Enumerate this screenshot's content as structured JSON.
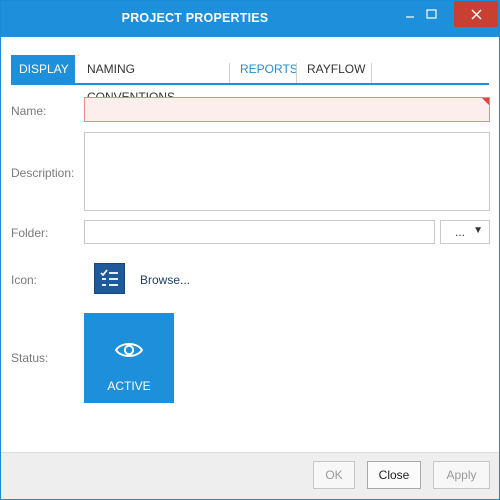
{
  "window": {
    "title": "PROJECT PROPERTIES"
  },
  "tabs": [
    {
      "label": "DISPLAY",
      "state": "active"
    },
    {
      "label": "NAMING CONVENTIONS",
      "state": "normal"
    },
    {
      "label": "REPORTS",
      "state": "link"
    },
    {
      "label": "RAYFLOW",
      "state": "normal"
    }
  ],
  "form": {
    "name": {
      "label": "Name:",
      "value": ""
    },
    "description": {
      "label": "Description:",
      "value": ""
    },
    "folder": {
      "label": "Folder:",
      "value": "",
      "dropdown_label": "..."
    },
    "icon": {
      "label": "Icon:",
      "browse_label": "Browse...",
      "icon_name": "checklist-icon"
    },
    "status": {
      "label": "Status:",
      "value": "ACTIVE",
      "icon_name": "eye-icon"
    }
  },
  "footer": {
    "ok_label": "OK",
    "close_label": "Close",
    "apply_label": "Apply"
  },
  "colors": {
    "accent": "#1e8fda",
    "close_button": "#c84031",
    "error_background": "#fdeeee",
    "error_corner": "#d8493b"
  }
}
